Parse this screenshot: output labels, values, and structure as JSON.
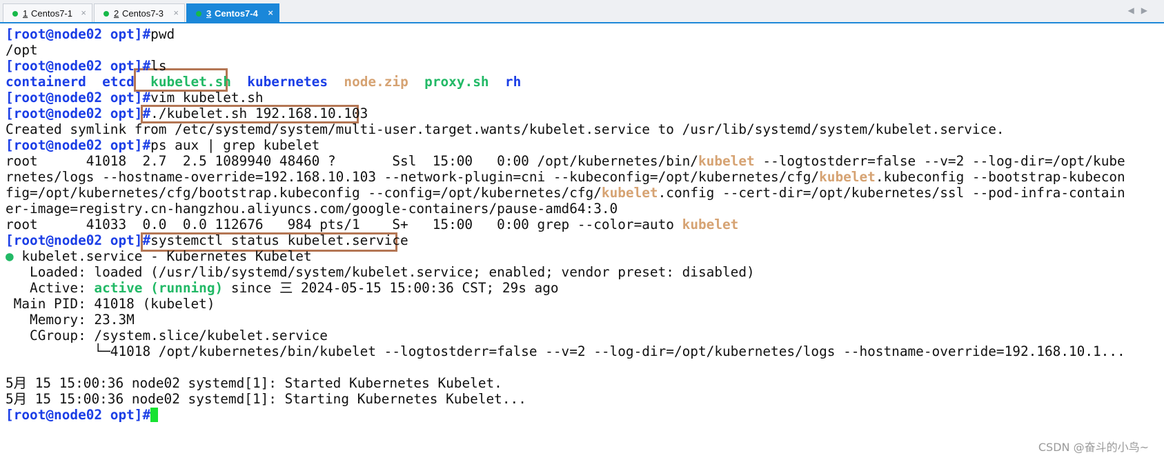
{
  "tabs": [
    {
      "num": "1",
      "label": "Centos7-1",
      "close": "×",
      "active": false
    },
    {
      "num": "2",
      "label": "Centos7-3",
      "close": "×",
      "active": false
    },
    {
      "num": "3",
      "label": "Centos7-4",
      "close": "×",
      "active": true
    }
  ],
  "nav": {
    "prev": "◀",
    "next": "▶"
  },
  "prompt": "[root@node02 opt]#",
  "colors": {
    "prompt": "#1b3ee6",
    "executable": "#22b966",
    "archive": "#d6a373",
    "highlight_box": "#b47654",
    "cursor": "#17e232",
    "tab_active": "#1a87d9"
  },
  "terminal": {
    "cmd_pwd": "pwd",
    "out_pwd": "/opt",
    "cmd_ls": "ls",
    "ls": {
      "containerd": "containerd",
      "etcd": "etcd",
      "kubelet_sh": "kubelet.sh",
      "kubernetes": "kubernetes",
      "node_zip": "node.zip",
      "proxy_sh": "proxy.sh",
      "rh": "rh"
    },
    "cmd_vim": "vim kubelet.sh",
    "cmd_run": "./kubelet.sh 192.168.10.103",
    "out_symlink": "Created symlink from /etc/systemd/system/multi-user.target.wants/kubelet.service to /usr/lib/systemd/system/kubelet.service.",
    "cmd_ps": "ps aux | grep kubelet",
    "kw": "kubelet",
    "ps1_a": "root      41018  2.7  2.5 1089940 48460 ?       Ssl  15:00   0:00 /opt/kubernetes/bin/",
    "ps1_b": " --logtostderr=false --v=2 --log-dir=/opt/kube",
    "ps2_a": "rnetes/logs --hostname-override=192.168.10.103 --network-plugin=cni --kubeconfig=/opt/kubernetes/cfg/",
    "ps2_b": ".kubeconfig --bootstrap-kubecon",
    "ps3_a": "fig=/opt/kubernetes/cfg/bootstrap.kubeconfig --config=/opt/kubernetes/cfg/",
    "ps3_b": ".config --cert-dir=/opt/kubernetes/ssl --pod-infra-contain",
    "ps4": "er-image=registry.cn-hangzhou.aliyuncs.com/google-containers/pause-amd64:3.0",
    "ps5_a": "root      41033  0.0  0.0 112676   984 pts/1    S+   15:00   0:00 grep --color=auto ",
    "cmd_status": "systemctl status kubelet.service",
    "st_bullet": "●",
    "st_title": " kubelet.service - Kubernetes Kubelet",
    "st_loaded": "   Loaded: loaded (/usr/lib/systemd/system/kubelet.service; enabled; vendor preset: disabled)",
    "st_active_a": "   Active: ",
    "st_active_b": "active (running)",
    "st_active_c": " since 三 2024-05-15 15:00:36 CST; 29s ago",
    "st_pid": " Main PID: 41018 (kubelet)",
    "st_mem": "   Memory: 23.3M",
    "st_cgroup": "   CGroup: /system.slice/kubelet.service",
    "st_proc": "           └─41018 /opt/kubernetes/bin/kubelet --logtostderr=false --v=2 --log-dir=/opt/kubernetes/logs --hostname-override=192.168.10.1...",
    "log1": "5月 15 15:00:36 node02 systemd[1]: Started Kubernetes Kubelet.",
    "log2": "5月 15 15:00:36 node02 systemd[1]: Starting Kubernetes Kubelet..."
  },
  "watermark": "CSDN @奋斗的小鸟~"
}
